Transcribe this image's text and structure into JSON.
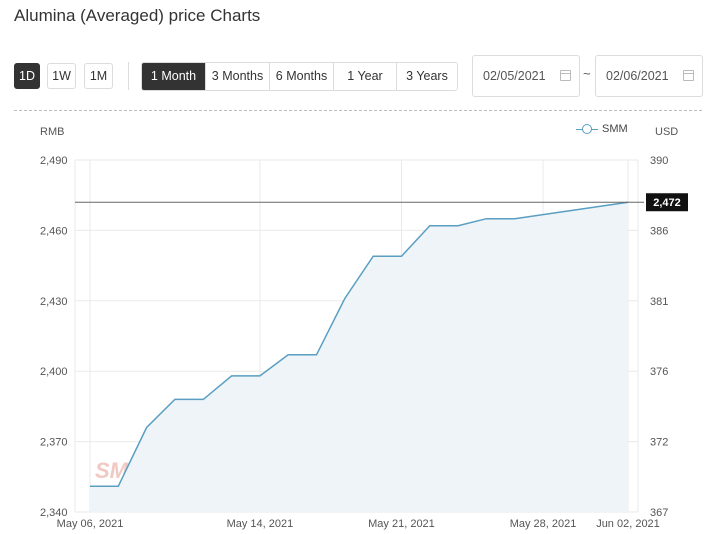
{
  "title": "Alumina (Averaged) price Charts",
  "interval_buttons": [
    {
      "label": "1D",
      "active": true
    },
    {
      "label": "1W",
      "active": false
    },
    {
      "label": "1M",
      "active": false
    }
  ],
  "range_buttons": [
    {
      "label": "1 Month",
      "active": true
    },
    {
      "label": "3 Months",
      "active": false
    },
    {
      "label": "6 Months",
      "active": false
    },
    {
      "label": "1 Year",
      "active": false
    },
    {
      "label": "3 Years",
      "active": false
    }
  ],
  "date_start": "02/05/2021",
  "date_separator": "~",
  "date_end": "02/06/2021",
  "colors": {
    "line": "#5a9ec2",
    "fill": "#eef4f8",
    "grid": "#eaeaea",
    "crosshair": "#666666",
    "badge": "#111111"
  },
  "chart_data": {
    "type": "area",
    "left_axis_label": "RMB",
    "right_axis_label": "USD",
    "legend": "SMM",
    "legend_position": "top-right",
    "watermark": "SMM",
    "ylim": [
      2340,
      2490
    ],
    "y_ticks": [
      "2,490",
      "2,460",
      "2,430",
      "2,400",
      "2,370",
      "2,340"
    ],
    "y_right_ticks": [
      "390",
      "386",
      "381",
      "376",
      "372",
      "367"
    ],
    "x_tick_labels": [
      "May 06, 2021",
      "May 14, 2021",
      "May 21, 2021",
      "May 28, 2021",
      "Jun 02, 2021"
    ],
    "x_tick_positions": [
      0,
      6,
      11,
      16,
      19
    ],
    "grid": true,
    "series": [
      {
        "name": "SMM",
        "values": [
          2351,
          2351,
          2376,
          2388,
          2388,
          2398,
          2398,
          2407,
          2407,
          2431,
          2449,
          2449,
          2462,
          2462,
          2465,
          2465,
          2472
        ]
      }
    ],
    "point_slots": [
      0,
      1,
      2,
      3,
      4,
      5,
      6,
      7,
      8,
      9,
      10,
      11,
      12,
      13,
      14,
      15,
      19
    ],
    "x_slot_count": 20,
    "current_value_label": "2,472",
    "current_value": 2472
  }
}
